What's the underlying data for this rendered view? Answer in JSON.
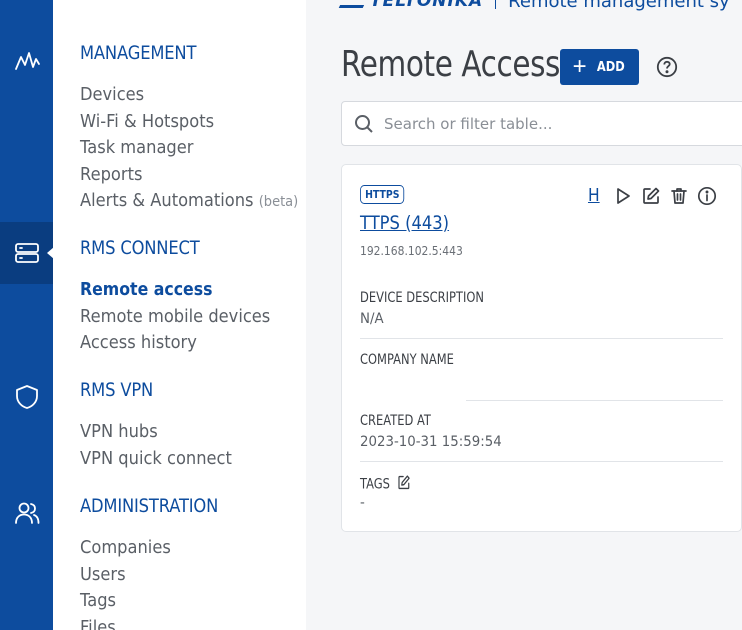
{
  "brand": {
    "logo": "TELTONIKA",
    "product": "Remote management sy"
  },
  "rail": {
    "items": [
      {
        "icon": "activity-icon"
      },
      {
        "icon": "server-icon",
        "active": true
      },
      {
        "icon": "shield-icon"
      },
      {
        "icon": "users-icon"
      }
    ]
  },
  "nav": {
    "management": {
      "heading": "MANAGEMENT",
      "items": [
        "Devices",
        "Wi-Fi & Hotspots",
        "Task manager",
        "Reports",
        "Alerts & Automations"
      ],
      "beta": "(beta)"
    },
    "rms_connect": {
      "heading": "RMS CONNECT",
      "items": [
        "Remote access",
        "Remote mobile devices",
        "Access history"
      ]
    },
    "rms_vpn": {
      "heading": "RMS VPN",
      "items": [
        "VPN hubs",
        "VPN quick connect"
      ]
    },
    "administration": {
      "heading": "ADMINISTRATION",
      "items": [
        "Companies",
        "Users",
        "Tags",
        "Files"
      ]
    }
  },
  "page": {
    "title": "Remote Access",
    "add_label": "ADD",
    "search_placeholder": "Search or filter table..."
  },
  "card": {
    "badge": "HTTPS",
    "title": "TTPS (443)",
    "h_link": "H",
    "address": "192.168.102.5:443",
    "device_description_label": "DEVICE DESCRIPTION",
    "device_description": "N/A",
    "company_name_label": "COMPANY NAME",
    "company_name": "",
    "created_at_label": "CREATED AT",
    "created_at": "2023-10-31 15:59:54",
    "tags_label": "TAGS",
    "tags": "-"
  },
  "colors": {
    "primary": "#0d4c9e",
    "rail_active": "#0a3d80",
    "text": "#3b3f45"
  }
}
